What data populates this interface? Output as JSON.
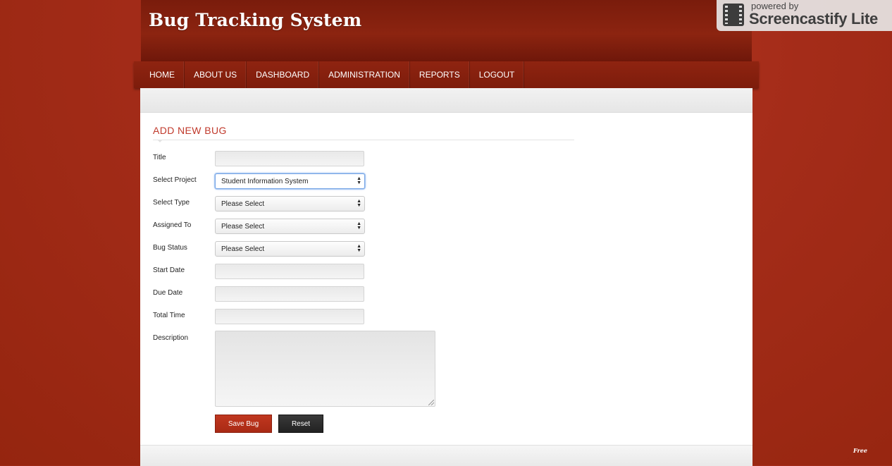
{
  "header": {
    "site_title": "Bug Tracking System"
  },
  "nav": {
    "items": [
      {
        "label": "HOME"
      },
      {
        "label": "ABOUT US"
      },
      {
        "label": "DASHBOARD"
      },
      {
        "label": "ADMINISTRATION"
      },
      {
        "label": "REPORTS"
      },
      {
        "label": "LOGOUT"
      }
    ]
  },
  "form": {
    "section_title": "ADD NEW BUG",
    "title_label": "Title",
    "title_value": "",
    "project_label": "Select Project",
    "project_value": "Student Information System",
    "type_label": "Select Type",
    "type_value": "Please Select",
    "assigned_label": "Assigned To",
    "assigned_value": "Please Select",
    "status_label": "Bug Status",
    "status_value": "Please Select",
    "start_label": "Start Date",
    "due_label": "Due Date",
    "total_label": "Total Time",
    "description_label": "Description",
    "save_label": "Save Bug",
    "reset_label": "Reset"
  },
  "watermark": {
    "small": "powered by",
    "big": "Screencastify Lite",
    "icon": "film-strip-icon"
  },
  "corner_mark": "Free",
  "colors": {
    "background": "#a62d1a",
    "nav": "#8f2411",
    "accent_title": "#c0392b",
    "save_button": "#b4301a",
    "reset_button": "#2e2e2e"
  }
}
